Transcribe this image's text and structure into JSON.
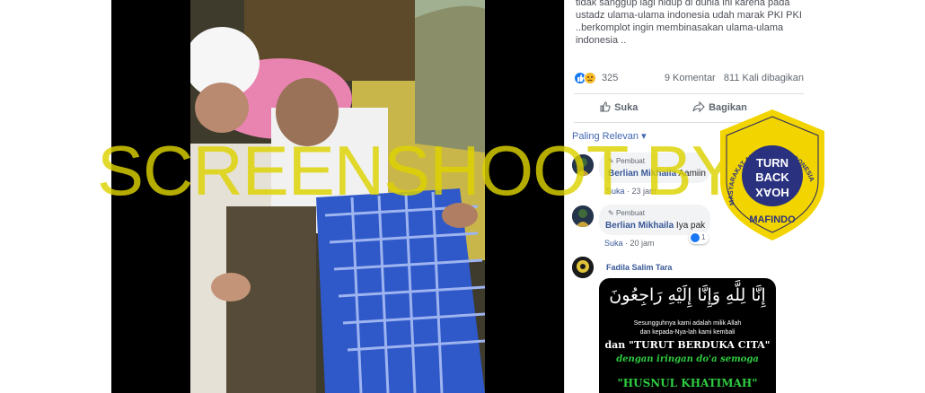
{
  "watermark": {
    "text": "SCREENSHOOT BY",
    "color": "#ddd200"
  },
  "post": {
    "text_lines": [
      "tidak sanggup lagi hidup di dunia ini karena pada",
      "ustadz ulama-ulama indonesia udah marak PKI PKI",
      "..berkomplot ingin membinasakan ulama-ulama",
      "indonesia .."
    ],
    "reaction_count": "325",
    "comments_count": "9 Komentar",
    "shares_count": "811 Kali dibagikan"
  },
  "actions": {
    "like": "Suka",
    "share": "Bagikan"
  },
  "sort": {
    "label": "Paling Relevan"
  },
  "comments": [
    {
      "badge": "Pembuat",
      "author": "Berlian Mikhaila",
      "text": "Aamiin",
      "like_label": "Suka",
      "time": "23 jam"
    },
    {
      "badge": "Pembuat",
      "author": "Berlian Mikhaila",
      "text": "Iya pak",
      "like_label": "Suka",
      "time": "20 jam",
      "reactions": "1"
    },
    {
      "author": "Fadila Salim Tara"
    }
  ],
  "condolence_image": {
    "arabic": "إِنَّا لِلَّهِ وَإِنَّا إِلَيْهِ رَاجِعُونَ",
    "line1": "Sesungguhnya kami adalah milik Allah",
    "line1b": "dan kepada-Nya-lah kami kembali",
    "line2": "dan \"TURUT BERDUKA CITA\"",
    "line3": "dengan iringan do'a semoga",
    "line4": "\"HUSNUL KHATIMAH\""
  },
  "mafindo_badge": {
    "arc_text": "MASYARAKAT ANTI FITNAH INDONESIA",
    "center_line1": "TURN",
    "center_line2": "BACK",
    "center_line3": "HOAX",
    "bottom_text": "MAFINDO",
    "color": "#f2d400"
  },
  "colors": {
    "facebook_blue": "#1877f2",
    "link_blue": "#385898",
    "meta_gray": "#606770"
  }
}
